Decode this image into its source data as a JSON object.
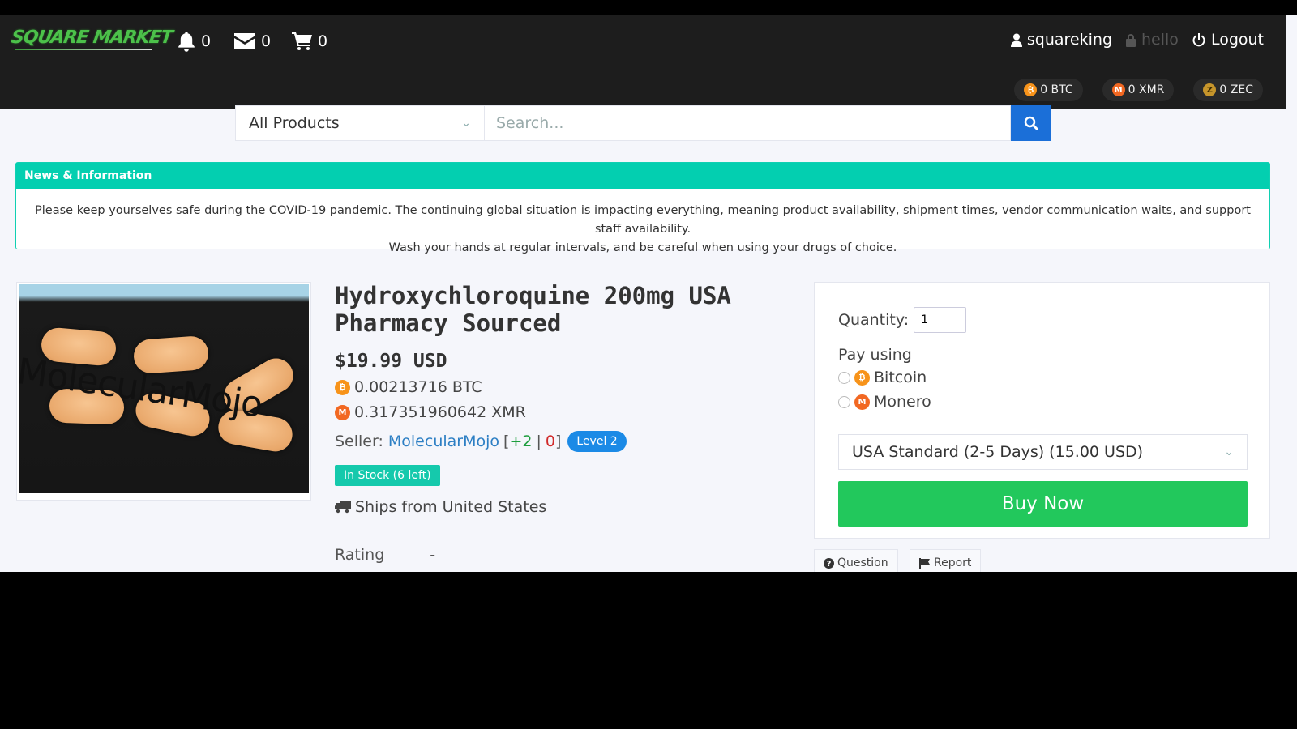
{
  "header": {
    "logo": "SQUARE MARKET",
    "notifications_count": "0",
    "messages_count": "0",
    "cart_count": "0",
    "username": "squareking",
    "pgp_label": "hello",
    "logout_label": "Logout",
    "balances": [
      {
        "currency": "BTC",
        "label": "0 BTC",
        "icon": "bitcoin-icon",
        "color": "#f7931a"
      },
      {
        "currency": "XMR",
        "label": "0 XMR",
        "icon": "monero-icon",
        "color": "#f26822"
      },
      {
        "currency": "ZEC",
        "label": "0 ZEC",
        "icon": "zcash-icon",
        "color": "#c6952b"
      }
    ]
  },
  "search": {
    "category_selected": "All Products",
    "placeholder": "Search...",
    "value": ""
  },
  "news": {
    "title": "News & Information",
    "line1": "Please keep yourselves safe during the COVID-19 pandemic. The continuing global situation is impacting everything, meaning product availability, shipment times, vendor communication waits, and support staff availability.",
    "line2": "Wash your hands at regular intervals, and be careful when using your drugs of choice."
  },
  "product": {
    "image_watermark": "MolecularMojo",
    "title": "Hydroxychloroquine 200mg USA Pharmacy Sourced",
    "price_usd": "$19.99 USD",
    "price_btc": "0.00213716 BTC",
    "price_xmr": "0.317351960642 XMR",
    "seller_label": "Seller:",
    "seller_name": "MolecularMojo",
    "feedback_open": "[",
    "feedback_positive": "+2",
    "feedback_sep": "|",
    "feedback_negative": "0",
    "feedback_close": "]",
    "seller_level": "Level 2",
    "stock": "In Stock (6 left)",
    "ships_from": "Ships from United States",
    "rating_label": "Rating",
    "rating_value": "-"
  },
  "purchase": {
    "quantity_label": "Quantity:",
    "quantity_value": "1",
    "pay_using_label": "Pay using",
    "payment_options": [
      {
        "label": "Bitcoin",
        "selected": false
      },
      {
        "label": "Monero",
        "selected": false
      }
    ],
    "shipping_selected": "USA Standard (2-5 Days) (15.00 USD)",
    "buy_label": "Buy Now",
    "question_label": "Question",
    "report_label": "Report"
  },
  "colors": {
    "header_bg": "#1d1d1d",
    "logo_green": "#4cc14a",
    "search_button": "#1b6fd8",
    "news_teal": "#03cfb0",
    "buy_green": "#22c85c",
    "level_blue": "#1b8ae6",
    "seller_link": "#2d7fc4"
  }
}
